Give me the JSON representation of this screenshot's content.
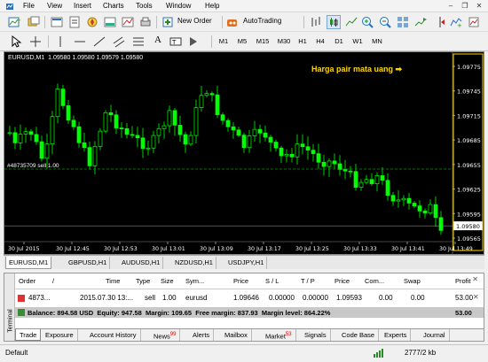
{
  "menu": [
    "File",
    "View",
    "Insert",
    "Charts",
    "Tools",
    "Window",
    "Help"
  ],
  "toolbar": {
    "new_order": "New Order",
    "autotrading": "AutoTrading"
  },
  "timeframes": [
    "M1",
    "M5",
    "M15",
    "M30",
    "H1",
    "H4",
    "D1",
    "W1",
    "MN"
  ],
  "chart": {
    "header": "EURUSD,M1  1.09580 1.09580 1.09579 1.09580",
    "annotation": "Harga pair mata uang ➡",
    "order_line_label": "#48735709 sell 1.00",
    "current_price": "1.09580",
    "price_labels": [
      "1.09775",
      "1.09745",
      "1.09715",
      "1.09685",
      "1.09655",
      "1.09625",
      "1.09595",
      "1.09565"
    ],
    "time_labels": [
      "30 Jul 2015",
      "30 Jul 12:45",
      "30 Jul 12:53",
      "30 Jul 13:01",
      "30 Jul 13:09",
      "30 Jul 13:17",
      "30 Jul 13:25",
      "30 Jul 13:33",
      "30 Jul 13:41",
      "30 Jul 13:49"
    ],
    "colors": {
      "background": "#000000",
      "candle": "#00ff00",
      "annotation": "#ffd700",
      "order_line": "#00a000"
    }
  },
  "chart_tabs": [
    "EURUSD,M1",
    "GBPUSD,H1",
    "AUDUSD,H1",
    "NZDUSD,H1",
    "USDJPY,H1"
  ],
  "terminal": {
    "side_label": "Terminal",
    "headers": [
      "Order",
      "/",
      "Time",
      "Type",
      "Size",
      "Sym...",
      "Price",
      "S / L",
      "T / P",
      "Price",
      "Com...",
      "Swap",
      "Profit"
    ],
    "row": {
      "order": "4873...",
      "time": "2015.07.30 13:...",
      "type": "sell",
      "size": "1.00",
      "symbol": "eurusd",
      "price": "1.09646",
      "sl": "0.00000",
      "tp": "0.00000",
      "cur_price": "1.09593",
      "commission": "0.00",
      "swap": "0.00",
      "profit": "53.00"
    },
    "balance_line": "Balance: 894.58 USD  Equity: 947.58  Margin: 109.65  Free margin: 837.93  Margin level: 864.22%",
    "balance_profit": "53.00",
    "tabs": [
      {
        "label": "Trade",
        "badge": ""
      },
      {
        "label": "Exposure",
        "badge": ""
      },
      {
        "label": "Account History",
        "badge": ""
      },
      {
        "label": "News",
        "badge": "99"
      },
      {
        "label": "Alerts",
        "badge": ""
      },
      {
        "label": "Mailbox",
        "badge": ""
      },
      {
        "label": "Market",
        "badge": "53"
      },
      {
        "label": "Signals",
        "badge": ""
      },
      {
        "label": "Code Base",
        "badge": ""
      },
      {
        "label": "Experts",
        "badge": ""
      },
      {
        "label": "Journal",
        "badge": ""
      }
    ]
  },
  "status": {
    "left": "Default",
    "traffic": "2777/2 kb"
  }
}
